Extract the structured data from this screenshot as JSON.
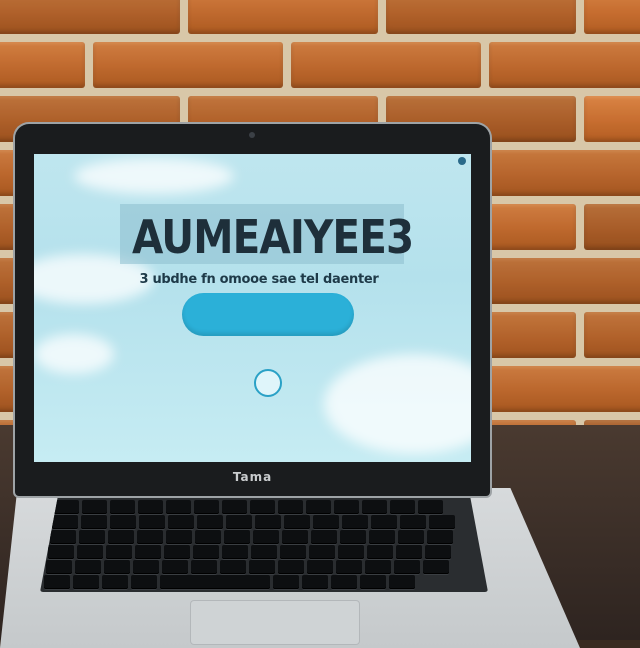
{
  "screen": {
    "nav_left": "",
    "nav_items": [
      "",
      ""
    ],
    "nav_right": "",
    "hero_title": "AUMEAIYEE3",
    "subtitle": "3 ubdhe fn omooe sae tel daenter",
    "cta_label": "",
    "round_button_label": "",
    "footer_lines": [
      "",
      ""
    ]
  },
  "laptop": {
    "bezel_label": "Tama"
  },
  "colors": {
    "brick": "#b8652c",
    "mortar": "#d8c7a8",
    "screen_sky": "#bfe6ef",
    "cta": "#2bb0d8",
    "title_text": "#1e2f3a"
  }
}
